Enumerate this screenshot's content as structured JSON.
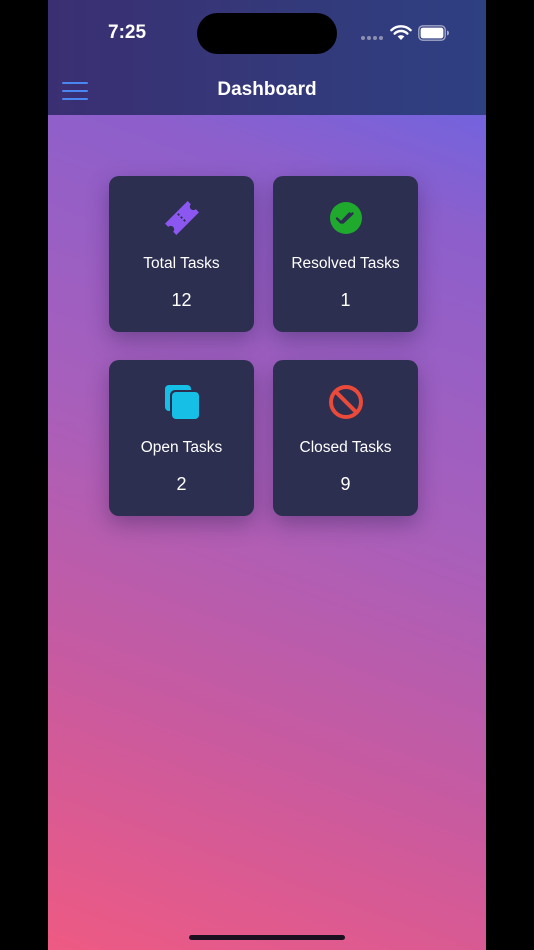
{
  "status_bar": {
    "time": "7:25"
  },
  "header": {
    "title": "Dashboard",
    "menu_icon": "hamburger-menu-icon"
  },
  "colors": {
    "header_background": "#333a7b",
    "card_background": "#2c2f4f",
    "menu_accent": "#4a86f0",
    "total_icon": "#8c57f0",
    "resolved_icon": "#1faa2e",
    "open_icon": "#15bfe6",
    "closed_icon": "#ea4a3a"
  },
  "dashboard": {
    "cards": [
      {
        "label": "Total Tasks",
        "count": "12",
        "icon": "ticket-icon"
      },
      {
        "label": "Resolved Tasks",
        "count": "1",
        "icon": "double-check-icon"
      },
      {
        "label": "Open Tasks",
        "count": "2",
        "icon": "stacked-squares-icon"
      },
      {
        "label": "Closed Tasks",
        "count": "9",
        "icon": "prohibited-icon"
      }
    ]
  }
}
